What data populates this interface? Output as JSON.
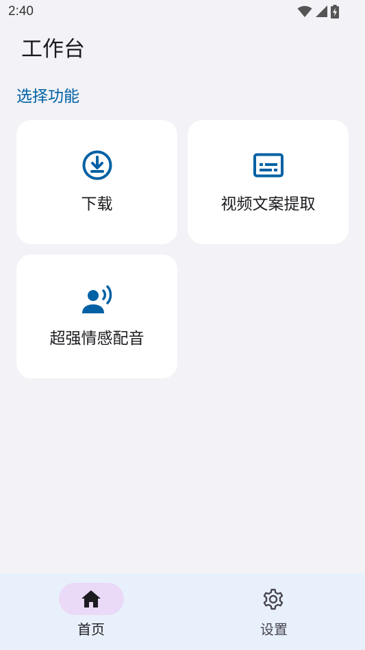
{
  "status_bar": {
    "time": "2:40",
    "icons": [
      "wifi-icon",
      "signal-icon",
      "battery-charging-icon"
    ]
  },
  "header": {
    "title": "工作台"
  },
  "section": {
    "label": "选择功能"
  },
  "cards": [
    {
      "label": "下载",
      "icon": "download-circle-icon"
    },
    {
      "label": "视频文案提取",
      "icon": "subtitles-icon"
    },
    {
      "label": "超强情感配音",
      "icon": "voice-person-icon"
    }
  ],
  "bottom_nav": {
    "items": [
      {
        "label": "首页",
        "icon": "home-icon",
        "selected": true
      },
      {
        "label": "设置",
        "icon": "gear-icon",
        "selected": false
      }
    ]
  },
  "colors": {
    "accent": "#0061a4",
    "background": "#f2f2f7",
    "card": "#ffffff",
    "nav_background": "#e8f1fb",
    "nav_selected_pill": "#ead9f7"
  }
}
